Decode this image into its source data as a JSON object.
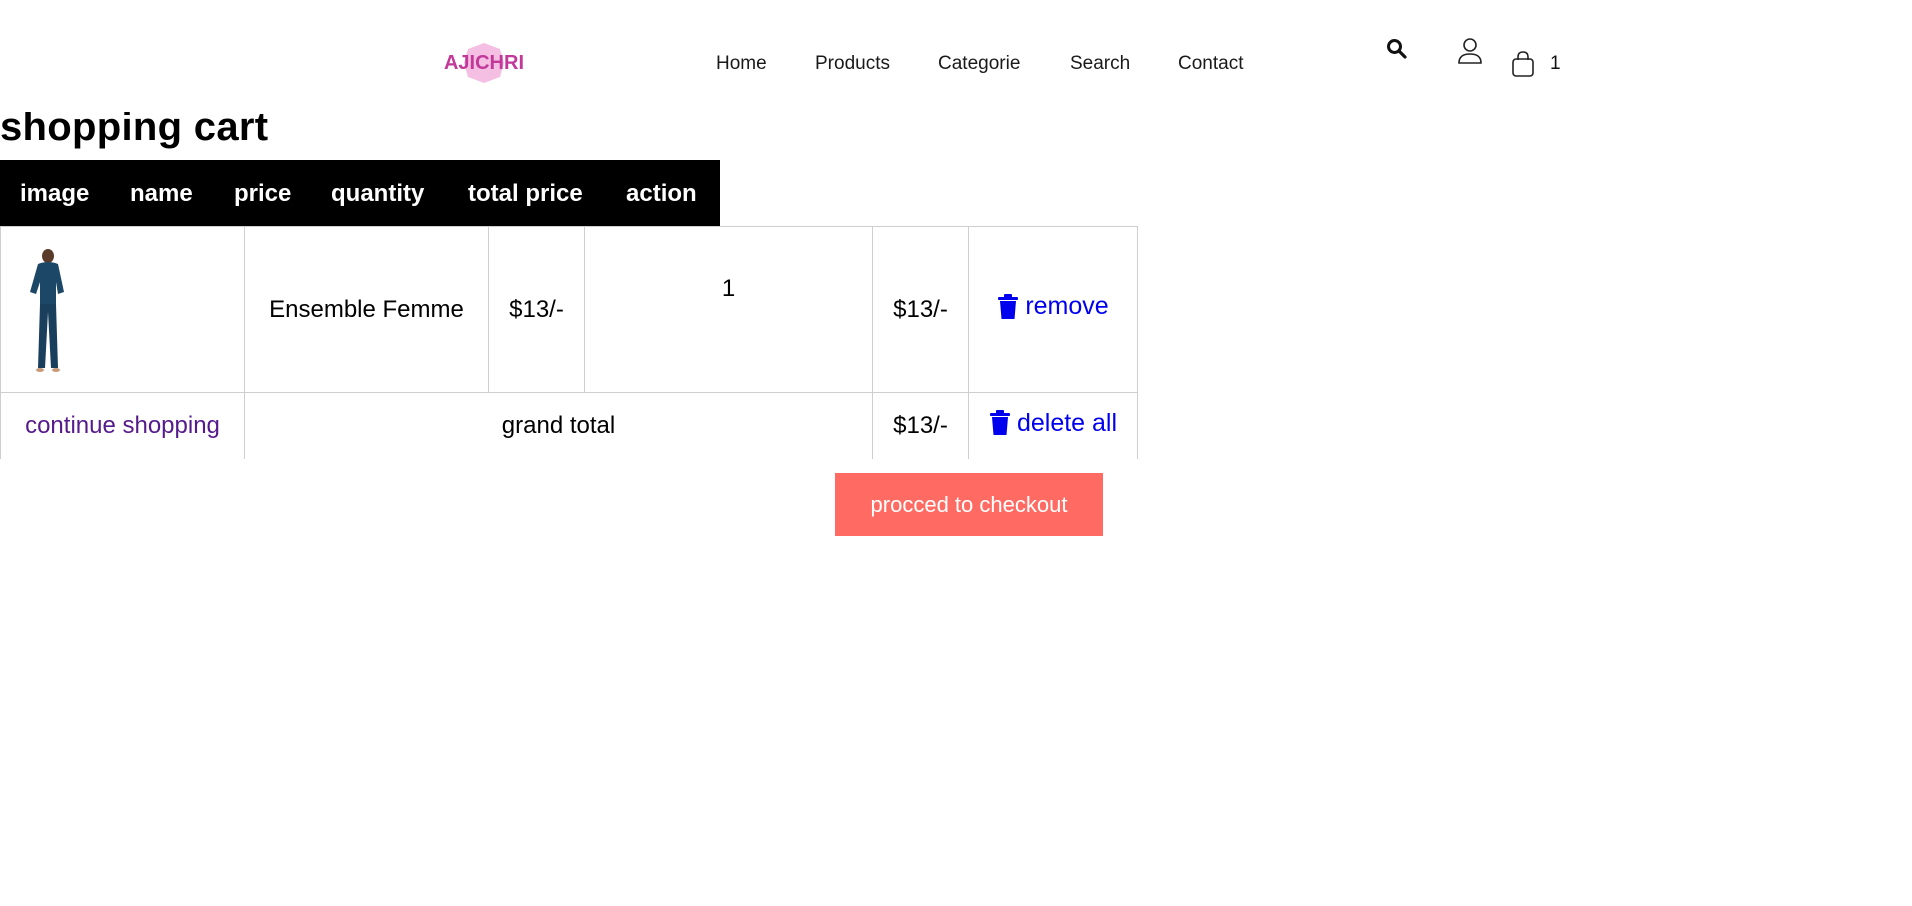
{
  "header": {
    "logo_text": "AJICHRI",
    "nav": [
      "Home",
      "Products",
      "Categorie",
      "Search",
      "Contact"
    ],
    "cart_count": "1",
    "icons": [
      "search-icon",
      "user-icon",
      "shopping-bag-icon"
    ]
  },
  "page": {
    "title": "shopping cart"
  },
  "table": {
    "headers": [
      "image",
      "name",
      "price",
      "quantity",
      "total price",
      "action"
    ],
    "items": [
      {
        "name": "Ensemble Femme",
        "price": "$13/-",
        "quantity": "1",
        "total": "$13/-",
        "action": "remove"
      }
    ],
    "footer": {
      "continue_label": "continue shopping",
      "grand_total_label": "grand total",
      "grand_total_value": "$13/-",
      "delete_all_label": "delete all"
    }
  },
  "checkout": {
    "label": "procced to checkout"
  },
  "colors": {
    "brand": "#c2399a",
    "checkout": "#ff6b62",
    "link": "#0000ee",
    "visited_link": "#551a8b"
  }
}
